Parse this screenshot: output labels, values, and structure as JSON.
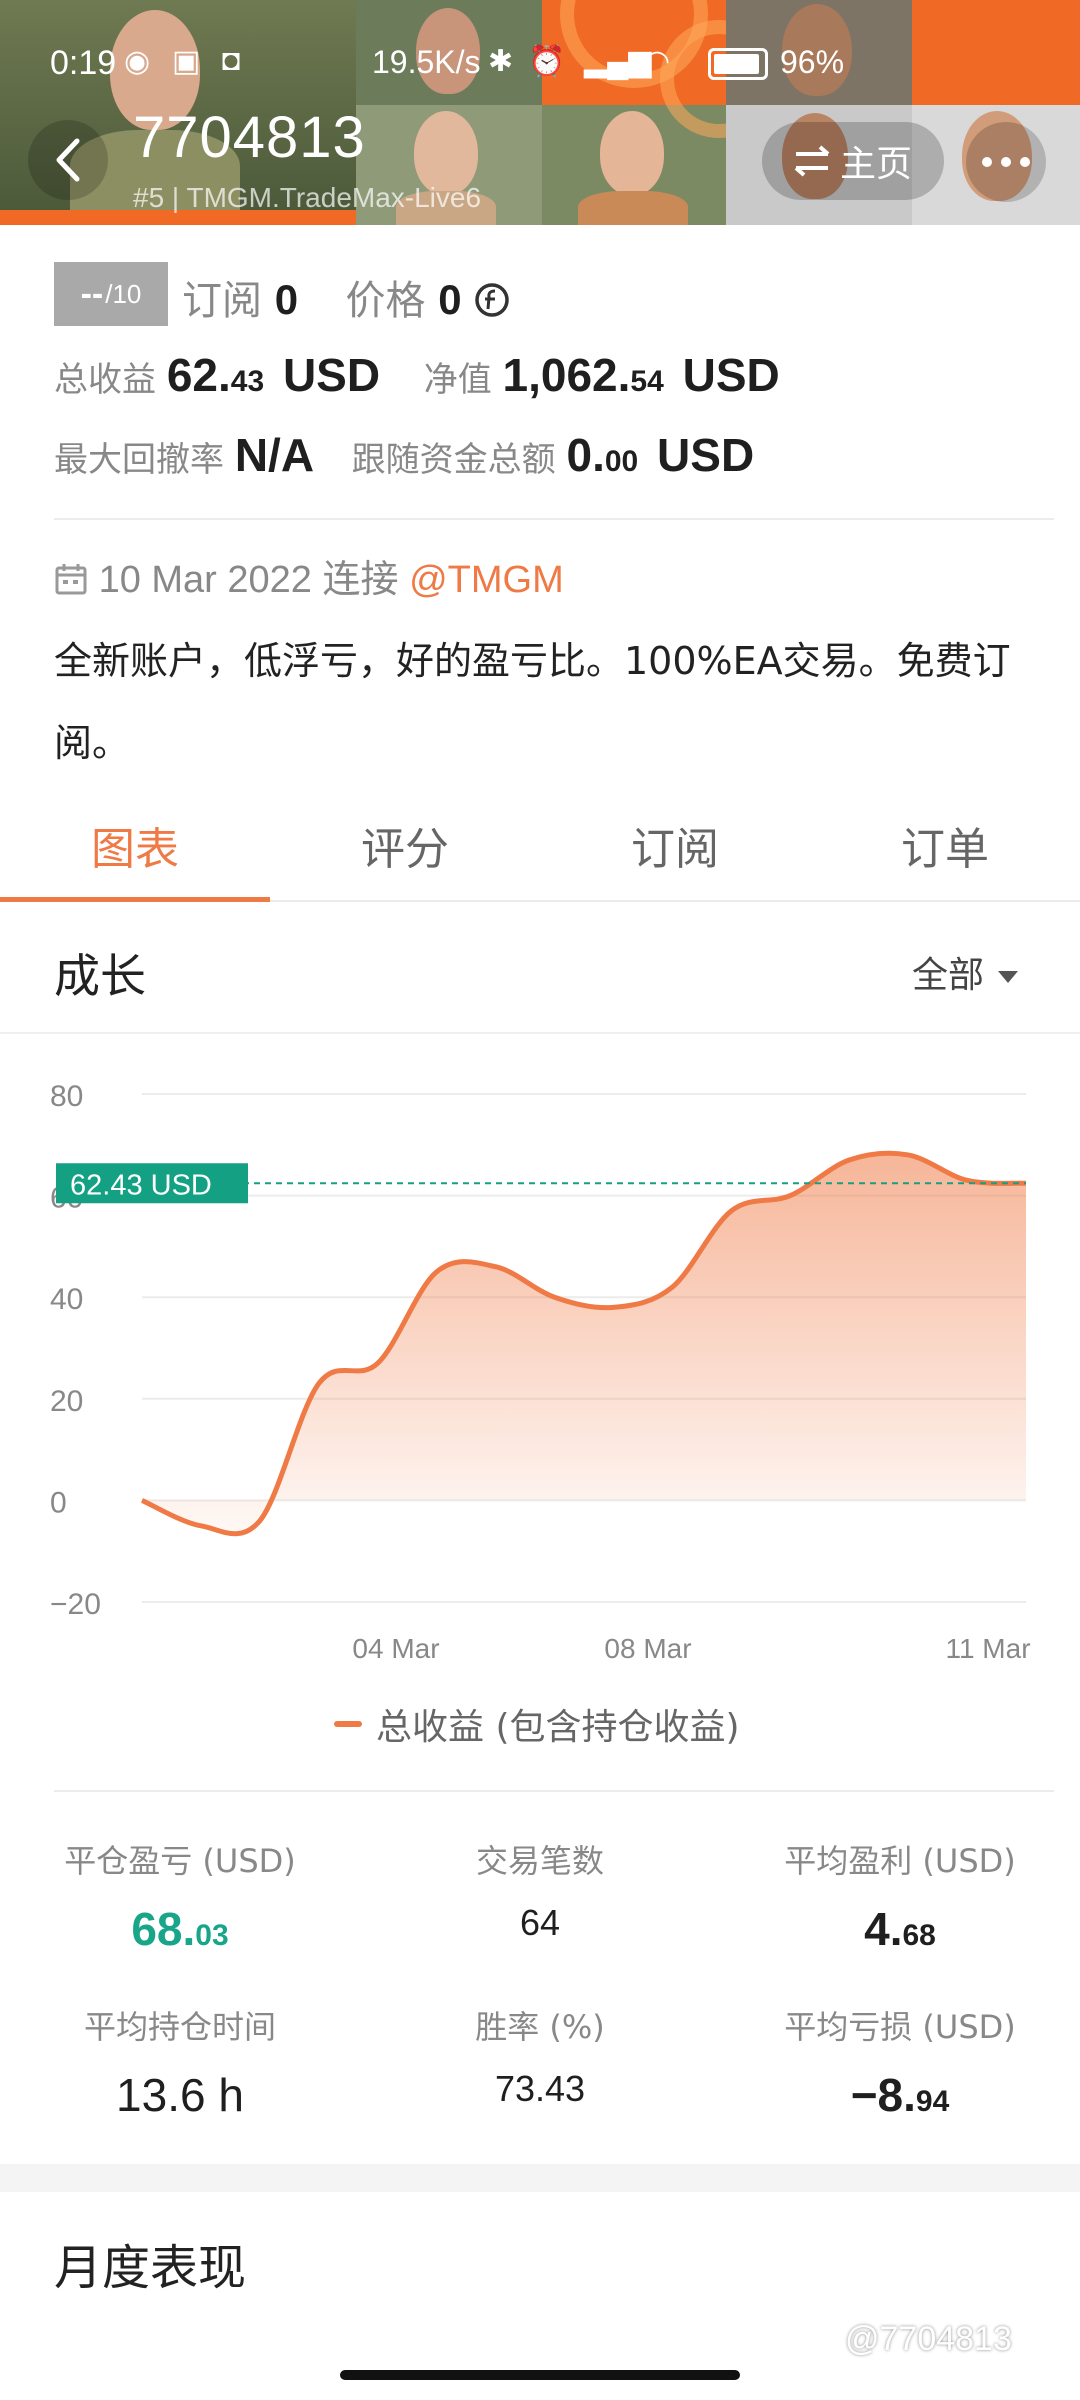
{
  "status_bar": {
    "time": "0:19",
    "speed": "19.5K/s",
    "battery": "96%"
  },
  "header": {
    "title": "7704813",
    "subtitle": "#5 | TMGM.TradeMax-Live6",
    "home_label": "主页"
  },
  "rating": {
    "score": "--",
    "out_of": "/10"
  },
  "info": {
    "subscribe_label": "订阅",
    "subscribe_value": "0",
    "price_label": "价格",
    "price_value": "0",
    "total_profit_label": "总收益",
    "total_profit_int": "62.",
    "total_profit_dec": "43",
    "total_profit_unit": "USD",
    "equity_label": "净值",
    "equity_int": "1,062.",
    "equity_dec": "54",
    "equity_unit": "USD",
    "max_dd_label": "最大回撤率",
    "max_dd_value": "N/A",
    "follow_label": "跟随资金总额",
    "follow_int": "0.",
    "follow_dec": "00",
    "follow_unit": "USD"
  },
  "connection": {
    "date": "10 Mar 2022",
    "connect_label": "连接",
    "broker": "@TMGM"
  },
  "description": "全新账户，低浮亏，好的盈亏比。100%EA交易。免费订阅。",
  "tabs": [
    {
      "label": "图表"
    },
    {
      "label": "评分"
    },
    {
      "label": "订阅"
    },
    {
      "label": "订单"
    }
  ],
  "growth": {
    "title": "成长",
    "filter": "全部"
  },
  "chart_data": {
    "type": "area",
    "yticks": [
      "80",
      "60",
      "40",
      "20",
      "0",
      "−20"
    ],
    "ylim": [
      -20,
      80
    ],
    "xticks": [
      "04 Mar",
      "08 Mar",
      "11 Mar"
    ],
    "series": [
      {
        "name": "总收益 (包含持仓收益)",
        "values": [
          0,
          -5,
          -4,
          23,
          27,
          45,
          46,
          40,
          38,
          42,
          57,
          60,
          67,
          68,
          63,
          62.43
        ]
      }
    ],
    "current_label": "62.43 USD",
    "current_value": 62.43,
    "color": "#ef7a45",
    "marker_color": "#14a083",
    "grid": true
  },
  "stats": {
    "closed_pl_label": "平仓盈亏 (USD)",
    "closed_pl_int": "68.",
    "closed_pl_dec": "03",
    "trades_label": "交易笔数",
    "trades_value": "64",
    "avg_profit_label": "平均盈利 (USD)",
    "avg_profit_int": "4.",
    "avg_profit_dec": "68",
    "hold_time_label": "平均持仓时间",
    "hold_time_value": "13.6 h",
    "win_rate_label": "胜率 (%)",
    "win_rate_value": "73.43",
    "avg_loss_label": "平均亏损 (USD)",
    "avg_loss_int": "−8.",
    "avg_loss_dec": "94"
  },
  "monthly": {
    "title": "月度表现"
  },
  "watermark": "@7704813"
}
